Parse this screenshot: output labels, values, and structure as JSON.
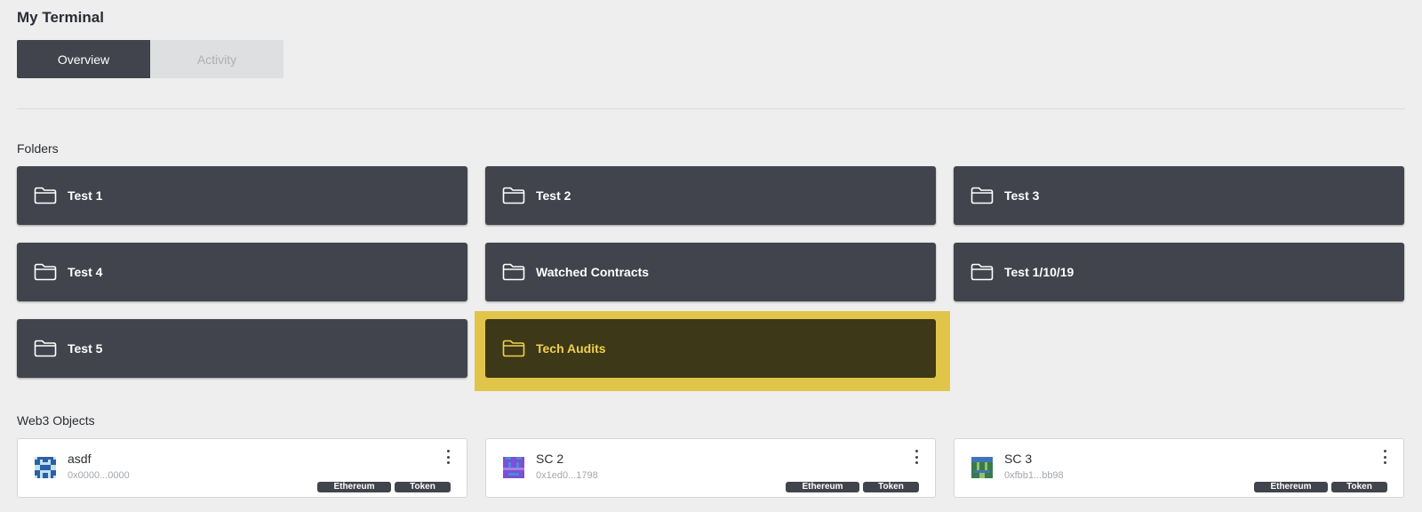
{
  "header": {
    "title": "My Terminal"
  },
  "tabs": [
    {
      "label": "Overview",
      "active": true
    },
    {
      "label": "Activity",
      "active": false
    }
  ],
  "folders_section": {
    "label": "Folders",
    "items": [
      {
        "name": "Test 1"
      },
      {
        "name": "Test 2"
      },
      {
        "name": "Test 3"
      },
      {
        "name": "Test 4"
      },
      {
        "name": "Watched Contracts"
      },
      {
        "name": "Test 1/10/19"
      },
      {
        "name": "Test 5"
      },
      {
        "name": "Tech Audits",
        "selected": true
      }
    ]
  },
  "web3_section": {
    "label": "Web3 Objects",
    "items": [
      {
        "name": "asdf",
        "address": "0x0000...0000",
        "tags": [
          "Ethereum",
          "Token"
        ],
        "avatar_color": "#2c5fa8"
      },
      {
        "name": "SC 2",
        "address": "0x1ed0...1798",
        "tags": [
          "Ethereum",
          "Token"
        ],
        "avatar_color": "#7b4fd6"
      },
      {
        "name": "SC 3",
        "address": "0xfbb1...bb98",
        "tags": [
          "Ethereum",
          "Token"
        ],
        "avatar_color": "#3a7a4a"
      }
    ]
  },
  "colors": {
    "dark_card": "#41444c",
    "highlight": "#e0c54a",
    "selected_folder_bg": "#3d3817",
    "selected_folder_text": "#f0d050"
  },
  "icons": {
    "folder": "folder-icon",
    "more": "more-vertical-icon"
  }
}
